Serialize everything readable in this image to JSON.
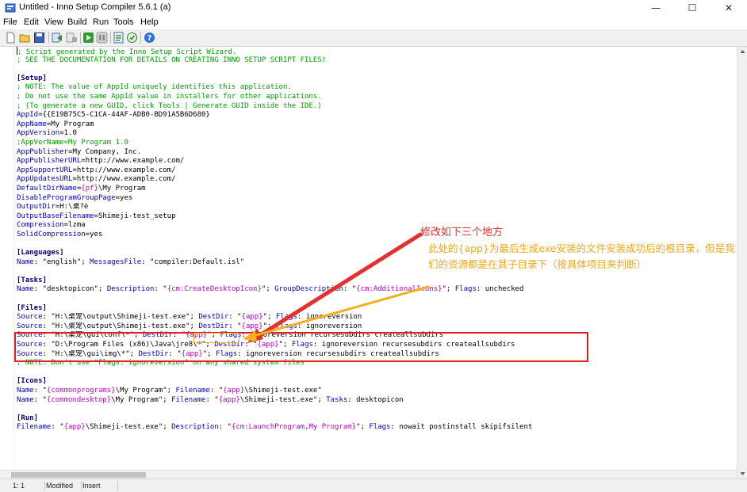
{
  "window": {
    "title": "Untitled - Inno Setup Compiler 5.6.1 (a)",
    "minimize_glyph": "—",
    "maximize_glyph": "☐",
    "close_glyph": "✕"
  },
  "menu": [
    "File",
    "Edit",
    "View",
    "Build",
    "Run",
    "Tools",
    "Help"
  ],
  "toolbar_icons": [
    "new-file-icon",
    "open-folder-icon",
    "save-icon",
    "compile-icon",
    "stop-compile-icon",
    "run-icon",
    "pause-icon",
    "terminate-icon",
    "target-setup-icon",
    "help-icon"
  ],
  "editor": {
    "lines": [
      [
        {
          "c": "c",
          "t": "; Script generated by the Inno Setup Script Wizard."
        }
      ],
      [
        {
          "c": "c",
          "t": "; SEE THE DOCUMENTATION FOR DETAILS ON CREATING INNO SETUP SCRIPT FILES!"
        }
      ],
      [],
      [
        {
          "c": "s",
          "t": "[Setup]"
        }
      ],
      [
        {
          "c": "c",
          "t": "; NOTE: The value of AppId uniquely identifies this application."
        }
      ],
      [
        {
          "c": "c",
          "t": "; Do not use the same AppId value in installers for other applications."
        }
      ],
      [
        {
          "c": "c",
          "t": "; (To generate a new GUID, click Tools | Generate GUID inside the IDE.)"
        }
      ],
      [
        {
          "c": "k",
          "t": "AppId"
        },
        {
          "c": "p",
          "t": "={{E19B75C5-C1CA-44AF-ADB0-BD91A5B6D680}"
        }
      ],
      [
        {
          "c": "k",
          "t": "AppName"
        },
        {
          "c": "p",
          "t": "=My Program"
        }
      ],
      [
        {
          "c": "k",
          "t": "AppVersion"
        },
        {
          "c": "p",
          "t": "=1.0"
        }
      ],
      [
        {
          "c": "c",
          "t": ";AppVerName=My Program 1.0"
        }
      ],
      [
        {
          "c": "k",
          "t": "AppPublisher"
        },
        {
          "c": "p",
          "t": "=My Company, Inc."
        }
      ],
      [
        {
          "c": "k",
          "t": "AppPublisherURL"
        },
        {
          "c": "p",
          "t": "=http://www.example.com/"
        }
      ],
      [
        {
          "c": "k",
          "t": "AppSupportURL"
        },
        {
          "c": "p",
          "t": "=http://www.example.com/"
        }
      ],
      [
        {
          "c": "k",
          "t": "AppUpdatesURL"
        },
        {
          "c": "p",
          "t": "=http://www.example.com/"
        }
      ],
      [
        {
          "c": "k",
          "t": "DefaultDirName"
        },
        {
          "c": "p",
          "t": "="
        },
        {
          "c": "m",
          "t": "{pf}"
        },
        {
          "c": "p",
          "t": "\\My Program"
        }
      ],
      [
        {
          "c": "k",
          "t": "DisableProgramGroupPage"
        },
        {
          "c": "p",
          "t": "=yes"
        }
      ],
      [
        {
          "c": "k",
          "t": "OutputDir"
        },
        {
          "c": "p",
          "t": "=H:\\桌?è"
        }
      ],
      [
        {
          "c": "k",
          "t": "OutputBaseFilename"
        },
        {
          "c": "p",
          "t": "=Shimeji-test_setup"
        }
      ],
      [
        {
          "c": "k",
          "t": "Compression"
        },
        {
          "c": "p",
          "t": "=lzma"
        }
      ],
      [
        {
          "c": "k",
          "t": "SolidCompression"
        },
        {
          "c": "p",
          "t": "=yes"
        }
      ],
      [],
      [
        {
          "c": "s",
          "t": "[Languages]"
        }
      ],
      [
        {
          "c": "k",
          "t": "Name"
        },
        {
          "c": "p",
          "t": ": \"english\"; "
        },
        {
          "c": "k",
          "t": "MessagesFile"
        },
        {
          "c": "p",
          "t": ": \"compiler:Default.isl\""
        }
      ],
      [],
      [
        {
          "c": "s",
          "t": "[Tasks]"
        }
      ],
      [
        {
          "c": "k",
          "t": "Name"
        },
        {
          "c": "p",
          "t": ": \"desktopicon\"; "
        },
        {
          "c": "k",
          "t": "Description"
        },
        {
          "c": "p",
          "t": ": \""
        },
        {
          "c": "m",
          "t": "{cm:CreateDesktopIcon}"
        },
        {
          "c": "p",
          "t": "\"; "
        },
        {
          "c": "k",
          "t": "GroupDescription"
        },
        {
          "c": "p",
          "t": ": \""
        },
        {
          "c": "m",
          "t": "{cm:AdditionalIcons}"
        },
        {
          "c": "p",
          "t": "\"; "
        },
        {
          "c": "k",
          "t": "Flags"
        },
        {
          "c": "p",
          "t": ": unchecked"
        }
      ],
      [],
      [
        {
          "c": "s",
          "t": "[Files]"
        }
      ],
      [
        {
          "c": "k",
          "t": "Source"
        },
        {
          "c": "p",
          "t": ": \"H:\\桌宠\\output\\Shimeji-test.exe\"; "
        },
        {
          "c": "k",
          "t": "DestDir"
        },
        {
          "c": "p",
          "t": ": \""
        },
        {
          "c": "m",
          "t": "{app}"
        },
        {
          "c": "p",
          "t": "\"; "
        },
        {
          "c": "k",
          "t": "Flags"
        },
        {
          "c": "p",
          "t": ": ignoreversion"
        }
      ],
      [
        {
          "c": "k",
          "t": "Source"
        },
        {
          "c": "p",
          "t": ": \"H:\\桌宠\\output\\Shimeji-test.exe\"; "
        },
        {
          "c": "k",
          "t": "DestDir"
        },
        {
          "c": "p",
          "t": ": \""
        },
        {
          "c": "m",
          "t": "{app}"
        },
        {
          "c": "p",
          "t": "\"; "
        },
        {
          "c": "k",
          "t": "Flags"
        },
        {
          "c": "p",
          "t": ": ignoreversion"
        }
      ],
      [
        {
          "c": "k",
          "t": "Source"
        },
        {
          "c": "p",
          "t": ": \"H:\\桌宠\\gui\\conf\\*\"; "
        },
        {
          "c": "k",
          "t": "DestDir"
        },
        {
          "c": "p",
          "t": ": \""
        },
        {
          "c": "m",
          "t": "{app}"
        },
        {
          "c": "p",
          "t": "\"; "
        },
        {
          "c": "k",
          "t": "Flags"
        },
        {
          "c": "p",
          "t": ": ignoreversion recursesubdirs createallsubdirs"
        }
      ],
      [
        {
          "c": "k",
          "t": "Source"
        },
        {
          "c": "p",
          "t": ": \"D:\\Program Files (x86)\\Java\\jre8\\*\"; "
        },
        {
          "c": "k",
          "t": "DestDir"
        },
        {
          "c": "p",
          "t": ": \""
        },
        {
          "c": "m",
          "t": "{app}"
        },
        {
          "c": "p",
          "t": "\"; "
        },
        {
          "c": "k",
          "t": "Flags"
        },
        {
          "c": "p",
          "t": ": ignoreversion recursesubdirs createallsubdirs"
        }
      ],
      [
        {
          "c": "k",
          "t": "Source"
        },
        {
          "c": "p",
          "t": ": \"H:\\桌宠\\gui\\img\\*\"; "
        },
        {
          "c": "k",
          "t": "DestDir"
        },
        {
          "c": "p",
          "t": ": \""
        },
        {
          "c": "m",
          "t": "{app}"
        },
        {
          "c": "p",
          "t": "\"; "
        },
        {
          "c": "k",
          "t": "Flags"
        },
        {
          "c": "p",
          "t": ": ignoreversion recursesubdirs createallsubdirs"
        }
      ],
      [
        {
          "c": "c",
          "t": "; NOTE: Don't use \"Flags: ignoreversion\" on any shared system files"
        }
      ],
      [],
      [
        {
          "c": "s",
          "t": "[Icons]"
        }
      ],
      [
        {
          "c": "k",
          "t": "Name"
        },
        {
          "c": "p",
          "t": ": \""
        },
        {
          "c": "m",
          "t": "{commonprograms}"
        },
        {
          "c": "p",
          "t": "\\My Program\"; "
        },
        {
          "c": "k",
          "t": "Filename"
        },
        {
          "c": "p",
          "t": ": \""
        },
        {
          "c": "m",
          "t": "{app}"
        },
        {
          "c": "p",
          "t": "\\Shimeji-test.exe\""
        }
      ],
      [
        {
          "c": "k",
          "t": "Name"
        },
        {
          "c": "p",
          "t": ": \""
        },
        {
          "c": "m",
          "t": "{commondesktop}"
        },
        {
          "c": "p",
          "t": "\\My Program\"; "
        },
        {
          "c": "k",
          "t": "Filename"
        },
        {
          "c": "p",
          "t": ": \""
        },
        {
          "c": "m",
          "t": "{app}"
        },
        {
          "c": "p",
          "t": "\\Shimeji-test.exe\"; "
        },
        {
          "c": "k",
          "t": "Tasks"
        },
        {
          "c": "p",
          "t": ": desktopicon"
        }
      ],
      [],
      [
        {
          "c": "s",
          "t": "[Run]"
        }
      ],
      [
        {
          "c": "k",
          "t": "Filename"
        },
        {
          "c": "p",
          "t": ": \""
        },
        {
          "c": "m",
          "t": "{app}"
        },
        {
          "c": "p",
          "t": "\\Shimeji-test.exe\"; "
        },
        {
          "c": "k",
          "t": "Description"
        },
        {
          "c": "p",
          "t": ": \""
        },
        {
          "c": "m",
          "t": "{cm:LaunchProgram,My Program}"
        },
        {
          "c": "p",
          "t": "\"; "
        },
        {
          "c": "k",
          "t": "Flags"
        },
        {
          "c": "p",
          "t": ": nowait postinstall skipifsilent"
        }
      ]
    ]
  },
  "annotation": {
    "title": "修改如下三个地方",
    "text": "此处的{app}为最后生成exe安装的文件安装成功后的根目录，但是我们的资源都是在其子目录下（按具体项目来判断）"
  },
  "status": {
    "position": "1:   1",
    "modified": "Modified",
    "mode": "Insert"
  },
  "colors": {
    "comment": "#00a000",
    "section": "#000080",
    "keyword": "#0000c8",
    "constant": "#c000c0",
    "annotation_red": "#e02020",
    "annotation_yellow": "#f0a818"
  }
}
